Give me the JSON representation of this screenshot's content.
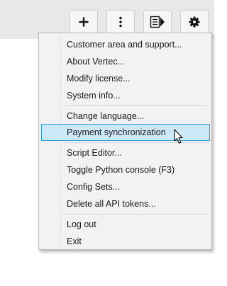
{
  "toolbar": {
    "buttons": [
      {
        "name": "plus-icon"
      },
      {
        "name": "more-vertical-icon"
      },
      {
        "name": "panel-toggle-icon"
      },
      {
        "name": "gear-icon"
      }
    ]
  },
  "menu": {
    "items": [
      {
        "label": "Customer area and support...",
        "highlighted": false
      },
      {
        "label": "About Vertec...",
        "highlighted": false
      },
      {
        "label": "Modify license...",
        "highlighted": false
      },
      {
        "label": "System info...",
        "highlighted": false
      },
      {
        "label": "Change language...",
        "highlighted": false
      },
      {
        "label": "Payment synchronization",
        "highlighted": true
      },
      {
        "label": "Script Editor...",
        "highlighted": false
      },
      {
        "label": "Toggle Python console (F3)",
        "highlighted": false
      },
      {
        "label": "Config Sets...",
        "highlighted": false
      },
      {
        "label": "Delete all API tokens...",
        "highlighted": false
      },
      {
        "label": "Log out",
        "highlighted": false
      },
      {
        "label": "Exit",
        "highlighted": false
      }
    ]
  },
  "colors": {
    "highlight_fill": "#cde8f6",
    "highlight_border": "#26a0da",
    "menu_background": "#f2f2f2",
    "toolbar_background": "#e8e8e8"
  },
  "cursor": {
    "icon": "arrow-cursor-icon"
  }
}
